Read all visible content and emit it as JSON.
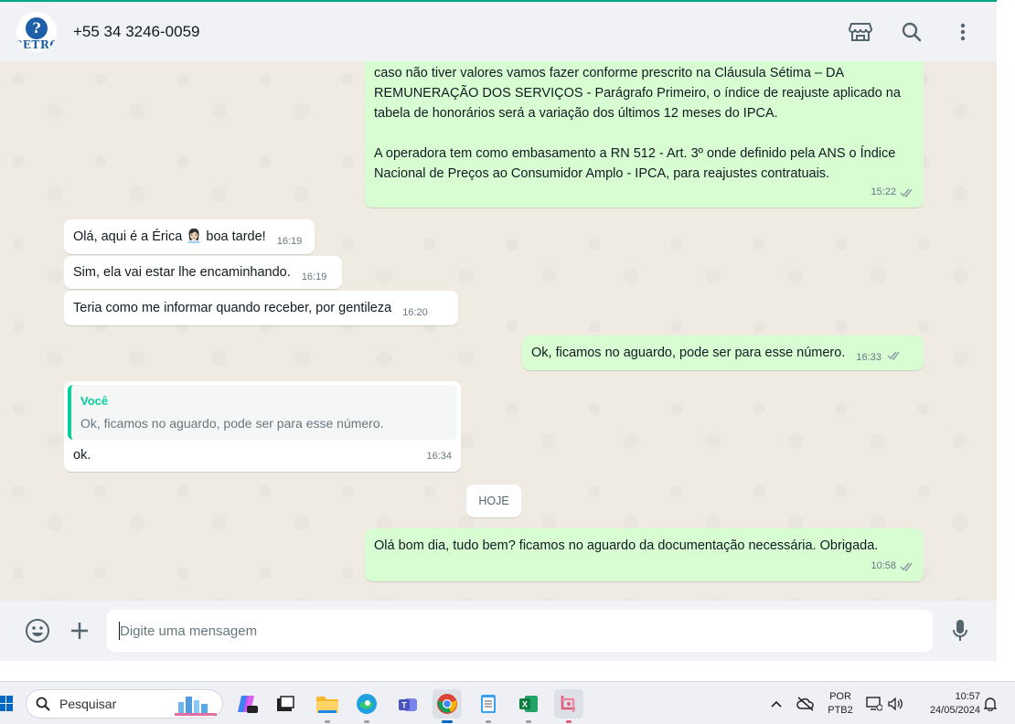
{
  "header": {
    "avatar_logo_text": "CETRO",
    "contact": "+55 34 3246-0059"
  },
  "messages": {
    "m1": {
      "text_p1": "caso não tiver valores vamos fazer conforme prescrito na Cláusula Sétima – DA REMUNERAÇÃO DOS SERVIÇOS - Parágrafo Primeiro, o índice de reajuste aplicado na tabela de honorários será a variação dos últimos 12 meses do IPCA.",
      "text_p2": "A operadora tem como embasamento a RN 512 - Art. 3º onde definido pela ANS o Índice Nacional de Preços ao Consumidor Amplo - IPCA, para reajustes contratuais.",
      "time": "15:22"
    },
    "m2": {
      "text": "Olá, aqui é a Érica",
      "text_after": " boa tarde!",
      "emoji": "👩🏻‍💼",
      "time": "16:19"
    },
    "m3": {
      "text": "Sim, ela vai estar lhe encaminhando.",
      "time": "16:19"
    },
    "m4": {
      "text": "Teria como me informar quando receber, por gentileza",
      "time": "16:20"
    },
    "m5": {
      "text": "Ok, ficamos no aguardo, pode ser para esse número.",
      "time": "16:33"
    },
    "m6": {
      "quote_author": "Você",
      "quote_text": "Ok, ficamos no aguardo, pode ser para esse número.",
      "text": "ok.",
      "time": "16:34"
    },
    "date_divider": "HOJE",
    "m7": {
      "text": "Olá bom dia, tudo bem? ficamos no aguardo da documentação necessária. Obrigada.",
      "time": "10:58"
    }
  },
  "composer": {
    "placeholder": "Digite uma mensagem"
  },
  "taskbar": {
    "search_label": "Pesquisar",
    "lang_line1": "POR",
    "lang_line2": "PTB2",
    "time": "10:57",
    "date": "24/05/2024"
  },
  "colors": {
    "accent": "#00a884",
    "outgoing_bubble": "#d9fdd3",
    "incoming_bubble": "#ffffff",
    "quote_accent": "#06cf9c"
  }
}
